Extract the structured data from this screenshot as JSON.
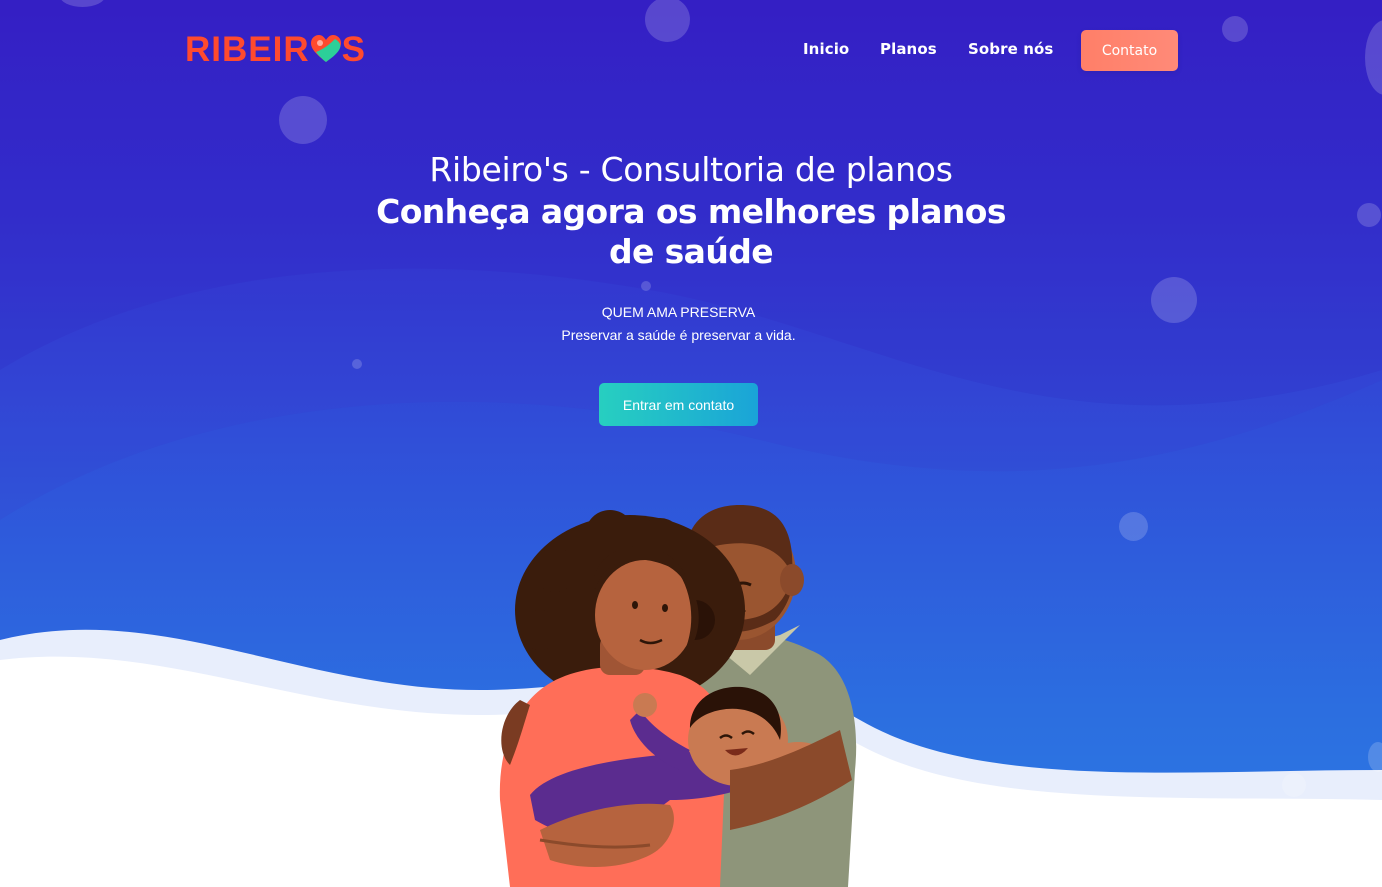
{
  "brand": {
    "logo_left": "RIBEIR",
    "logo_right": "S"
  },
  "nav": {
    "items": [
      "Inicio",
      "Planos",
      "Sobre nós"
    ],
    "contact_button": "Contato"
  },
  "hero": {
    "subtitle": "Ribeiro's - Consultoria de planos",
    "title_line1": "Conheça agora os melhores planos",
    "title_line2": "de saúde",
    "tagline": "QUEM AMA PRESERVA",
    "tagline_text": "Preservar a saúde é preservar a vida.",
    "cta_button": "Entrar em contato"
  },
  "colors": {
    "brand": "#ff4a2e",
    "hero_top": "#3621c8",
    "hero_bottom": "#2d7be4",
    "contact_button": "#ff8a78",
    "cta_start": "#27cfc0",
    "cta_end": "#1aa4d8"
  },
  "icons": {
    "logo_heart": "heart-icon"
  }
}
